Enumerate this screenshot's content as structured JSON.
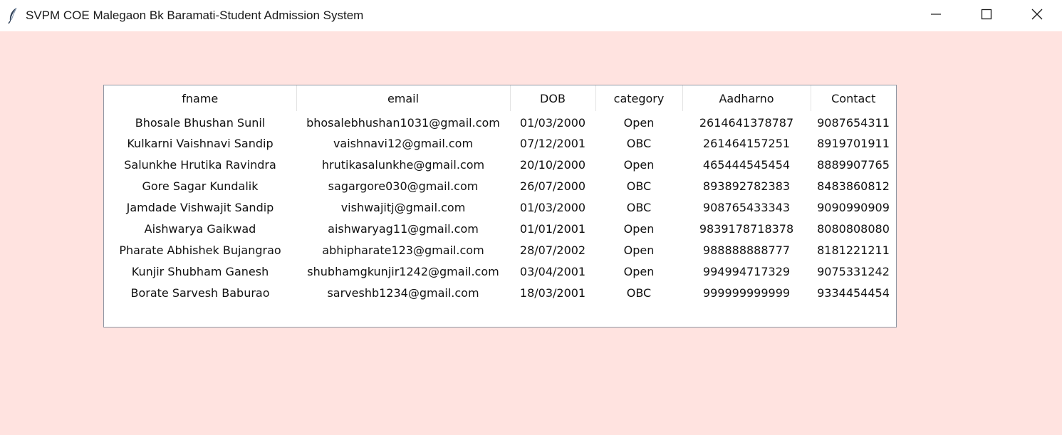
{
  "window": {
    "title": "SVPM COE Malegaon Bk Baramati-Student Admission System"
  },
  "table": {
    "headers": [
      "fname",
      "email",
      "DOB",
      "category",
      "Aadharno",
      "Contact"
    ],
    "rows": [
      [
        "Bhosale Bhushan Sunil",
        "bhosalebhushan1031@gmail.com",
        "01/03/2000",
        "Open",
        "2614641378787",
        "9087654311"
      ],
      [
        "Kulkarni Vaishnavi Sandip",
        "vaishnavi12@gmail.com",
        "07/12/2001",
        "OBC",
        "261464157251",
        "8919701911"
      ],
      [
        "Salunkhe Hrutika Ravindra",
        "hrutikasalunkhe@gmail.com",
        "20/10/2000",
        "Open",
        "465444545454",
        "8889907765"
      ],
      [
        "Gore Sagar Kundalik",
        "sagargore030@gmail.com",
        "26/07/2000",
        "OBC",
        "893892782383",
        "8483860812"
      ],
      [
        "Jamdade Vishwajit Sandip",
        "vishwajitj@gmail.com",
        "01/03/2000",
        "OBC",
        "908765433343",
        "9090990909"
      ],
      [
        "Aishwarya Gaikwad",
        "aishwaryag11@gmail.com",
        "01/01/2001",
        "Open",
        "9839178718378",
        "8080808080"
      ],
      [
        "Pharate Abhishek Bujangrao",
        "abhipharate123@gmail.com",
        "28/07/2002",
        "Open",
        "988888888777",
        "8181221211"
      ],
      [
        "Kunjir Shubham Ganesh",
        "shubhamgkunjir1242@gmail.com",
        "03/04/2001",
        "Open",
        "994994717329",
        "9075331242"
      ],
      [
        "Borate Sarvesh Baburao",
        "sarveshb1234@gmail.com",
        "18/03/2001",
        "OBC",
        "999999999999",
        "9334454454"
      ]
    ]
  },
  "icons": {
    "app": "feather-icon",
    "minimize": "minimize-icon",
    "maximize": "maximize-icon",
    "close": "close-icon"
  },
  "colors": {
    "background": "#ffe3e0",
    "titlebar": "#ffffff",
    "table_border": "#8f96a3"
  }
}
